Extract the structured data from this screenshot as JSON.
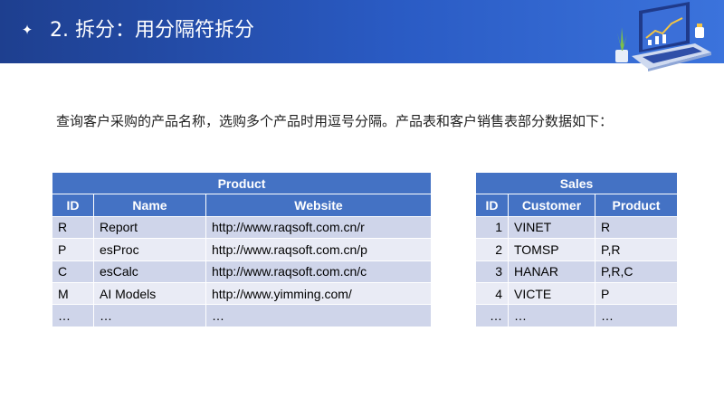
{
  "header": {
    "title": "2. 拆分：用分隔符拆分",
    "bullet_icon": "four-pointed-star-icon",
    "illustration_icon": "laptop-chart-icon"
  },
  "intro": "查询客户采购的产品名称，选购多个产品时用逗号分隔。产品表和客户销售表部分数据如下：",
  "product_table": {
    "caption": "Product",
    "columns": [
      "ID",
      "Name",
      "Website"
    ],
    "rows": [
      [
        "R",
        "Report",
        "http://www.raqsoft.com.cn/r"
      ],
      [
        "P",
        "esProc",
        "http://www.raqsoft.com.cn/p"
      ],
      [
        "C",
        "esCalc",
        "http://www.raqsoft.com.cn/c"
      ],
      [
        "M",
        "AI Models",
        "http://www.yimming.com/"
      ],
      [
        "…",
        "…",
        "…"
      ]
    ]
  },
  "sales_table": {
    "caption": "Sales",
    "columns": [
      "ID",
      "Customer",
      "Product"
    ],
    "rows": [
      [
        "1",
        "VINET",
        "R"
      ],
      [
        "2",
        "TOMSP",
        "P,R"
      ],
      [
        "3",
        "HANAR",
        "P,R,C"
      ],
      [
        "4",
        "VICTE",
        "P"
      ],
      [
        "…",
        "…",
        "…"
      ]
    ]
  },
  "colors": {
    "header_start": "#1e3f8f",
    "header_end": "#3b73dc",
    "table_header": "#4472c4",
    "row_dark": "#cfd5ea",
    "row_light": "#e9ebf5"
  }
}
